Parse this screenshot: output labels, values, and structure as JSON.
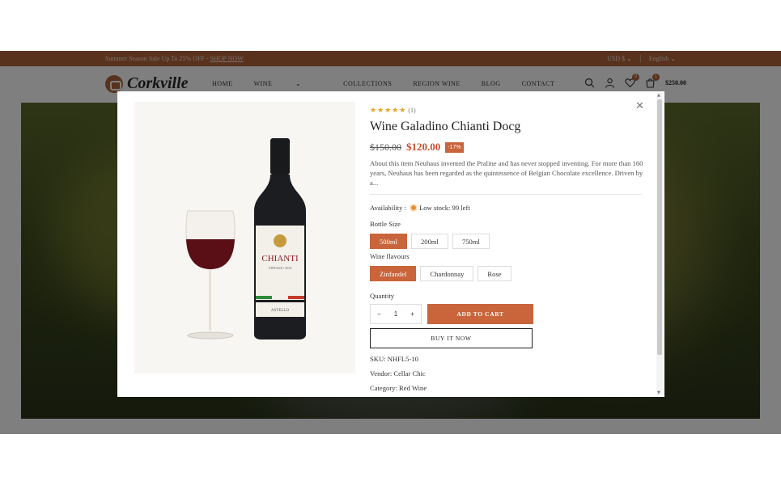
{
  "topbar": {
    "promo_text": "Summer Season Sale Up To 25% OFF - ",
    "promo_link": "SHOP NOW",
    "currency": "USD $",
    "language": "English"
  },
  "header": {
    "logo": "Corkville",
    "nav": [
      "HOME",
      "WINE",
      "COLLECTIONS",
      "REGION WINE",
      "BLOG",
      "CONTACT"
    ],
    "wishlist_count": "0",
    "cart_count": "1",
    "cart_total": "$250.00"
  },
  "product": {
    "rating_stars": "★★★★★",
    "rating_count": "(1)",
    "title": "Wine Galadino Chianti Docg",
    "old_price": "$150.00",
    "new_price": "$120.00",
    "discount": "-17%",
    "description": "About this item Neuhaus invented the Praline and has never stopped inventing. For more than 160 years, Neuhaus has been regarded as the quintessence of Belgian Chocolate excellence. Driven by a...",
    "availability_label": "Availability :",
    "availability_value": "Low stock: 99 left",
    "bottle_size_label": "Bottle Size",
    "bottle_sizes": [
      "500ml",
      "200ml",
      "750ml"
    ],
    "flavours_label": "Wine flavours",
    "flavours": [
      "Zinfandel",
      "Chardonnay",
      "Rose"
    ],
    "quantity_label": "Quantity",
    "quantity": "1",
    "add_to_cart": "ADD TO CART",
    "buy_now": "BUY IT NOW",
    "sku": "SKU: NHFL5-10",
    "vendor": "Vendor: Cellar Chic",
    "category": "Category: Red Wine",
    "bottle_label": "CHIANTI",
    "bottle_vintage": "VINTAGE • 2013",
    "bottle_maker": "ASTELLO"
  },
  "colors": {
    "accent": "#c9643b",
    "topbar": "#b3643c",
    "sale_price": "#c94f2c",
    "stars": "#e8a21c"
  }
}
